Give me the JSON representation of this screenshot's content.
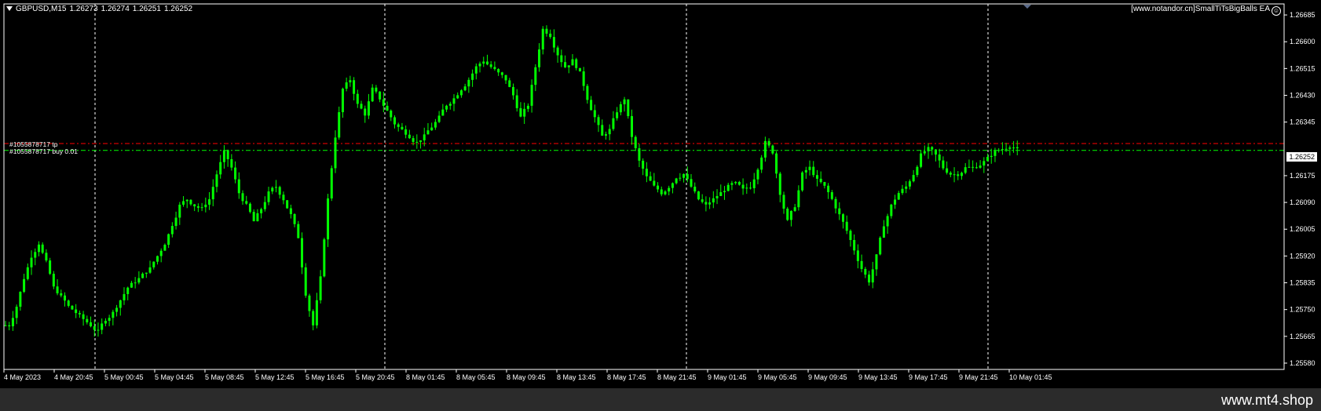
{
  "header": {
    "symbol_tf": "GBPUSD,M15",
    "open": "1.26273",
    "high": "1.26274",
    "low": "1.26251",
    "close": "1.26252"
  },
  "ea_label": "[www.notandor.cn]SmallTiTsBigBalls EA",
  "orders": {
    "tp_label": "#1055878717 tp",
    "buy_label": "#1055878717 buy 0.01"
  },
  "current_price_tag": "1.26252",
  "footer_brand": "www.mt4.shop",
  "colors": {
    "background": "#000000",
    "candle": "#00ff00",
    "tp_line": "#ff0000",
    "entry_line": "#00ff00",
    "grid": "#ffffff"
  },
  "chart_data": {
    "type": "line",
    "title": "GBPUSD,M15",
    "y_ticks": [
      "1.26685",
      "1.26600",
      "1.26515",
      "1.26430",
      "1.26345",
      "1.26175",
      "1.26090",
      "1.26005",
      "1.25920",
      "1.25835",
      "1.25750",
      "1.25665",
      "1.25580"
    ],
    "ylim": [
      1.2556,
      1.2672
    ],
    "x_ticks": [
      "4 May 2023",
      "4 May 20:45",
      "5 May 00:45",
      "5 May 04:45",
      "5 May 08:45",
      "5 May 12:45",
      "5 May 16:45",
      "5 May 20:45",
      "8 May 01:45",
      "8 May 05:45",
      "8 May 09:45",
      "8 May 13:45",
      "8 May 17:45",
      "8 May 21:45",
      "9 May 01:45",
      "9 May 05:45",
      "9 May 09:45",
      "9 May 13:45",
      "9 May 17:45",
      "9 May 21:45",
      "10 May 01:45"
    ],
    "tp_level": 1.26277,
    "entry_level": 1.26255,
    "close_series": [
      1.257,
      1.2576,
      1.2585,
      1.2592,
      1.2596,
      1.259,
      1.2582,
      1.2579,
      1.2576,
      1.2574,
      1.2572,
      1.257,
      1.2568,
      1.2572,
      1.2574,
      1.2578,
      1.2582,
      1.2584,
      1.2586,
      1.2588,
      1.2592,
      1.2596,
      1.2602,
      1.2608,
      1.261,
      1.2608,
      1.2607,
      1.261,
      1.2618,
      1.2625,
      1.262,
      1.2612,
      1.2608,
      1.2603,
      1.2607,
      1.2612,
      1.2614,
      1.261,
      1.2605,
      1.2598,
      1.258,
      1.257,
      1.2585,
      1.261,
      1.263,
      1.2645,
      1.2648,
      1.264,
      1.2637,
      1.2645,
      1.2642,
      1.2638,
      1.2634,
      1.2632,
      1.263,
      1.2628,
      1.263,
      1.2633,
      1.2636,
      1.264,
      1.2642,
      1.2645,
      1.2648,
      1.2652,
      1.2654,
      1.2652,
      1.265,
      1.2648,
      1.2643,
      1.2636,
      1.264,
      1.2652,
      1.2664,
      1.2662,
      1.2656,
      1.2652,
      1.2654,
      1.265,
      1.2642,
      1.2636,
      1.263,
      1.2632,
      1.2638,
      1.2642,
      1.263,
      1.2622,
      1.2617,
      1.2614,
      1.2612,
      1.2614,
      1.2617,
      1.2618,
      1.2614,
      1.261,
      1.2608,
      1.261,
      1.2612,
      1.2614,
      1.2615,
      1.2613,
      1.2614,
      1.262,
      1.2628,
      1.2625,
      1.2612,
      1.2603,
      1.2608,
      1.2618,
      1.262,
      1.2616,
      1.2614,
      1.261,
      1.2605,
      1.26,
      1.2594,
      1.2588,
      1.2584,
      1.2592,
      1.2602,
      1.2608,
      1.2612,
      1.2614,
      1.2618,
      1.2624,
      1.2626,
      1.2624,
      1.262,
      1.2618,
      1.2618,
      1.262,
      1.262,
      1.2621,
      1.2623,
      1.2625,
      1.2626,
      1.2627,
      1.2626
    ]
  }
}
